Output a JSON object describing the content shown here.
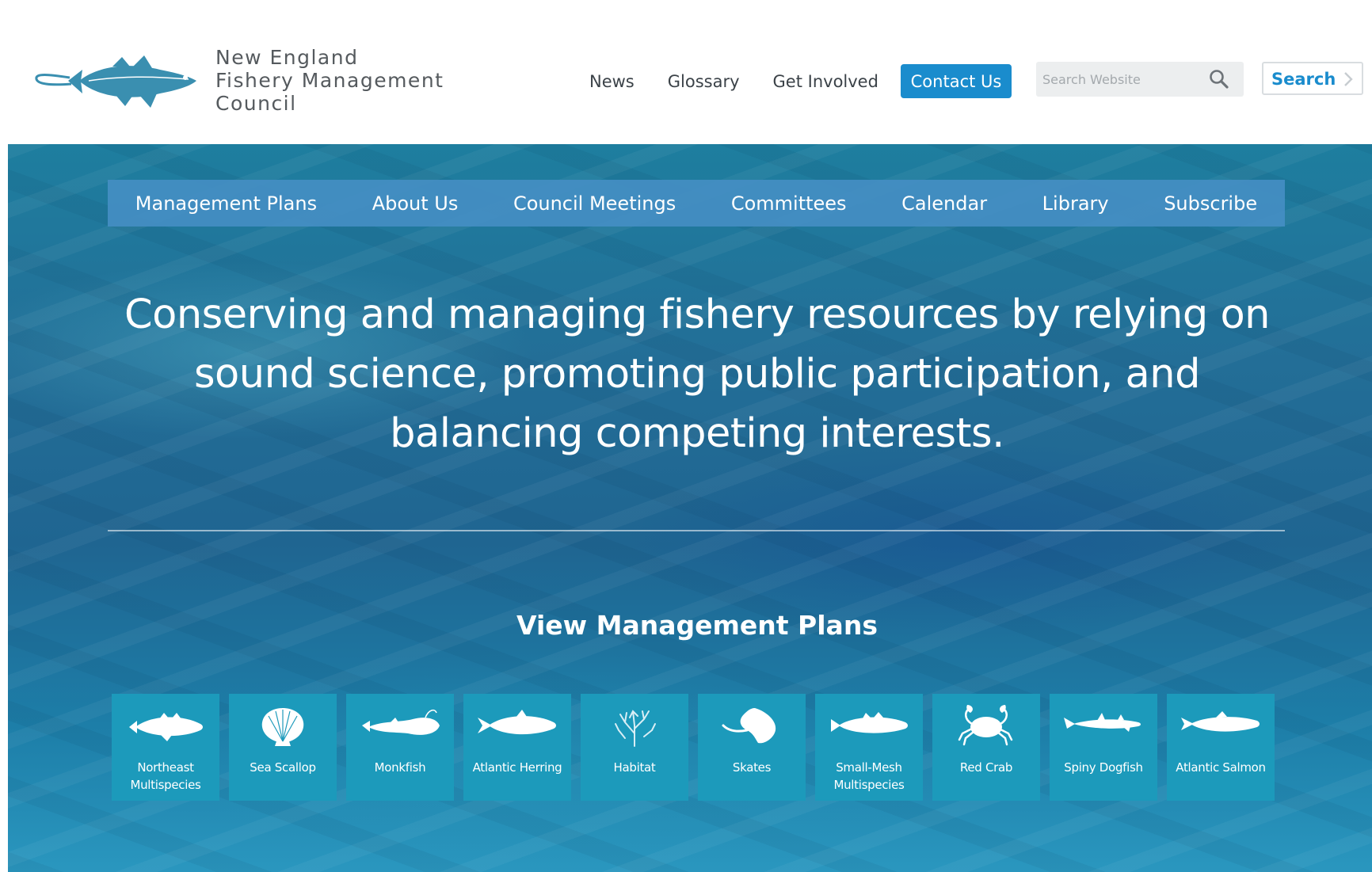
{
  "logo": {
    "line1": "New England",
    "line2": "Fishery Management",
    "line3": "Council",
    "icon": "cod-fish-logo"
  },
  "top_nav": {
    "items": [
      "News",
      "Glossary",
      "Get Involved"
    ],
    "contact_label": "Contact Us"
  },
  "search": {
    "placeholder": "Search Website",
    "value": "",
    "button_label": "Search",
    "icon": "search-icon"
  },
  "main_nav": {
    "items": [
      "Management Plans",
      "About Us",
      "Council Meetings",
      "Committees",
      "Calendar",
      "Library",
      "Subscribe"
    ]
  },
  "hero": {
    "tagline": "Conserving and managing fishery resources by relying on sound science, promoting public participation, and balancing competing interests.",
    "plans_heading": "View Management Plans"
  },
  "plans": [
    {
      "label": "Northeast Multispecies",
      "icon": "groundfish-icon"
    },
    {
      "label": "Sea Scallop",
      "icon": "scallop-icon"
    },
    {
      "label": "Monkfish",
      "icon": "monkfish-icon"
    },
    {
      "label": "Atlantic Herring",
      "icon": "herring-icon"
    },
    {
      "label": "Habitat",
      "icon": "coral-icon"
    },
    {
      "label": "Skates",
      "icon": "skate-icon"
    },
    {
      "label": "Small-Mesh Multispecies",
      "icon": "whiting-icon"
    },
    {
      "label": "Red Crab",
      "icon": "crab-icon"
    },
    {
      "label": "Spiny Dogfish",
      "icon": "dogfish-icon"
    },
    {
      "label": "Atlantic Salmon",
      "icon": "salmon-icon"
    }
  ],
  "colors": {
    "accent": "#1a8ccd",
    "nav_bar": "#448ec3",
    "tile": "#1c9abb",
    "logo_fish": "#3a8fb0"
  }
}
